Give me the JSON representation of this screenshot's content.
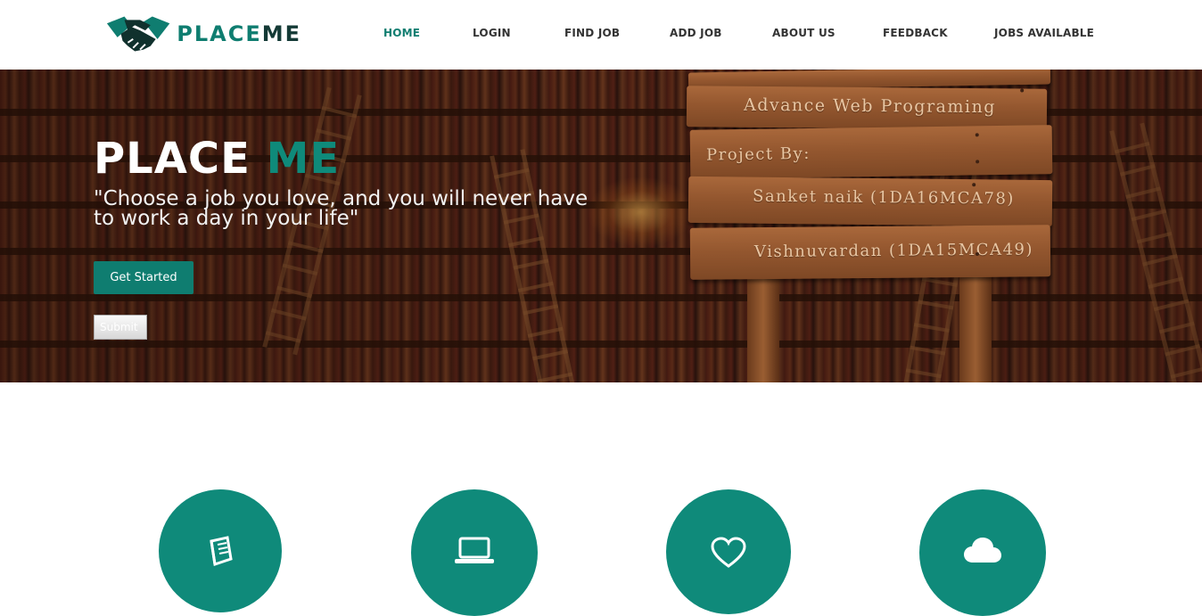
{
  "brand": {
    "name_part1": "PLACE",
    "name_part2": "ME",
    "accent": "#0f7d70"
  },
  "nav": {
    "items": [
      {
        "label": "HOME",
        "active": true
      },
      {
        "label": "LOGIN",
        "active": false
      },
      {
        "label": "FIND JOB",
        "active": false
      },
      {
        "label": "ADD JOB",
        "active": false
      },
      {
        "label": "ABOUT US",
        "active": false
      },
      {
        "label": "FEEDBACK",
        "active": false
      },
      {
        "label": "JOBS AVAILABLE",
        "active": false
      }
    ]
  },
  "hero": {
    "title_part1": "PLACE",
    "title_part2": "ME",
    "quote": "\"Choose a job you love, and you will never have to work a day in your life\"",
    "get_started_label": "Get Started",
    "submit_label": "Submit"
  },
  "sign": {
    "course": "Advance Web Programing",
    "heading": "Project By:",
    "member1": "Sanket naik (1DA16MCA78)",
    "member2": "Vishnuvardan (1DA15MCA49)"
  },
  "features": {
    "icons": [
      "book-icon",
      "laptop-icon",
      "heart-icon",
      "cloud-icon"
    ]
  }
}
